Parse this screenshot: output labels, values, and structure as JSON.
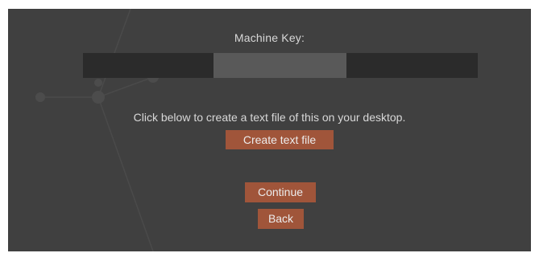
{
  "dialog": {
    "title": "Machine Key:",
    "machine_key_value": "",
    "instruction": "Click below to create a text file of this on your desktop.",
    "create_button_label": "Create text file",
    "continue_button_label": "Continue",
    "back_button_label": "Back"
  },
  "colors": {
    "panel_background": "#404040",
    "key_bar": "#2b2b2b",
    "key_field": "#595959",
    "button": "#a0553a",
    "text": "#d8d8d8"
  }
}
